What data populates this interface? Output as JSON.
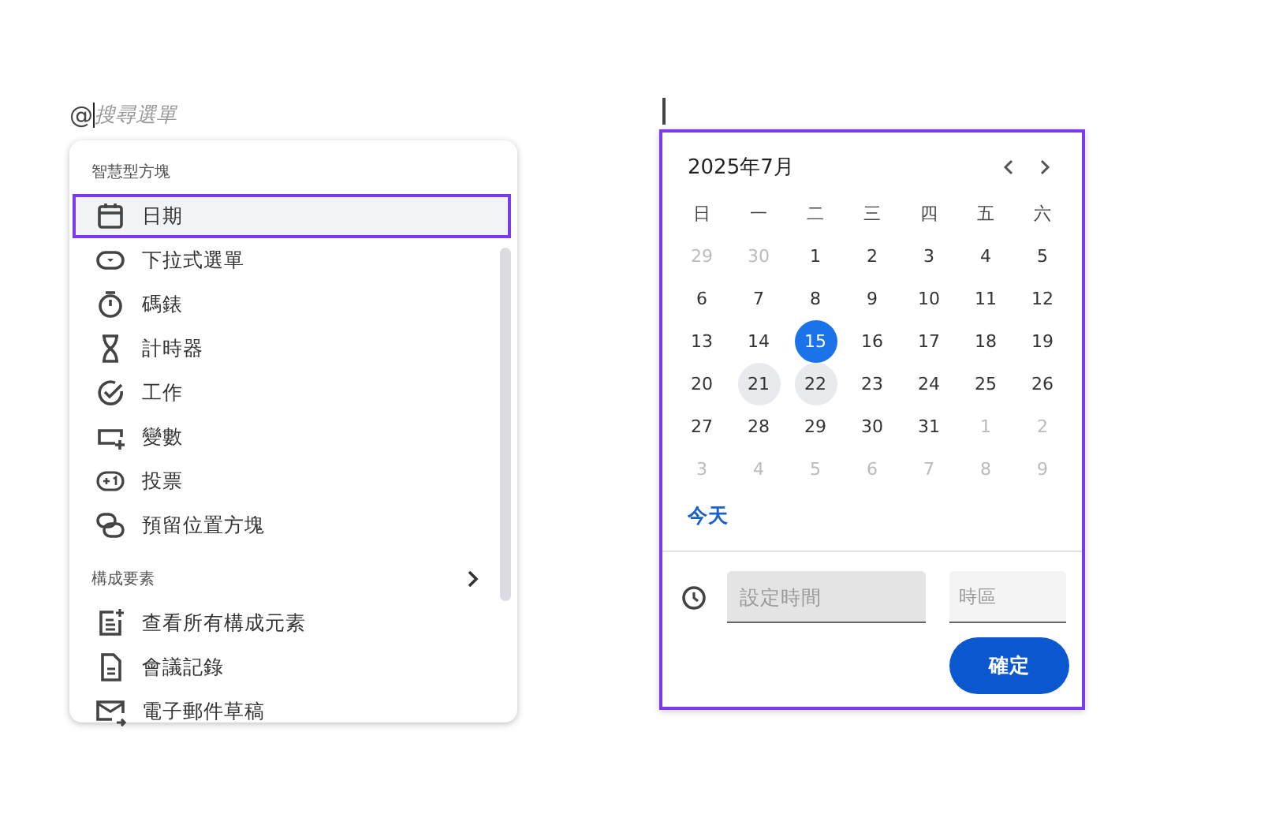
{
  "search": {
    "prefix": "@",
    "placeholder": "搜尋選單"
  },
  "menu": {
    "sections": [
      {
        "title": "智慧型方塊",
        "has_submenu": false,
        "items": [
          {
            "label": "日期",
            "kind": "calendar",
            "selected": true
          },
          {
            "label": "下拉式選單",
            "kind": "dropdown",
            "selected": false
          },
          {
            "label": "碼錶",
            "kind": "stopwatch",
            "selected": false
          },
          {
            "label": "計時器",
            "kind": "hourglass",
            "selected": false
          },
          {
            "label": "工作",
            "kind": "task",
            "selected": false
          },
          {
            "label": "變數",
            "kind": "variable",
            "selected": false
          },
          {
            "label": "投票",
            "kind": "vote",
            "selected": false
          },
          {
            "label": "預留位置方塊",
            "kind": "placeholder",
            "selected": false
          }
        ]
      },
      {
        "title": "構成要素",
        "has_submenu": true,
        "items": [
          {
            "label": "查看所有構成元素",
            "kind": "note-add",
            "selected": false
          },
          {
            "label": "會議記錄",
            "kind": "document",
            "selected": false
          },
          {
            "label": "電子郵件草稿",
            "kind": "mail",
            "selected": false
          }
        ]
      }
    ]
  },
  "calendar": {
    "title": "2025年7月",
    "weekdays": [
      "日",
      "一",
      "二",
      "三",
      "四",
      "五",
      "六"
    ],
    "days": [
      {
        "label": "29",
        "muted": true,
        "selected": false,
        "highlighted": false
      },
      {
        "label": "30",
        "muted": true,
        "selected": false,
        "highlighted": false
      },
      {
        "label": "1",
        "muted": false,
        "selected": false,
        "highlighted": false
      },
      {
        "label": "2",
        "muted": false,
        "selected": false,
        "highlighted": false
      },
      {
        "label": "3",
        "muted": false,
        "selected": false,
        "highlighted": false
      },
      {
        "label": "4",
        "muted": false,
        "selected": false,
        "highlighted": false
      },
      {
        "label": "5",
        "muted": false,
        "selected": false,
        "highlighted": false
      },
      {
        "label": "6",
        "muted": false,
        "selected": false,
        "highlighted": false
      },
      {
        "label": "7",
        "muted": false,
        "selected": false,
        "highlighted": false
      },
      {
        "label": "8",
        "muted": false,
        "selected": false,
        "highlighted": false
      },
      {
        "label": "9",
        "muted": false,
        "selected": false,
        "highlighted": false
      },
      {
        "label": "10",
        "muted": false,
        "selected": false,
        "highlighted": false
      },
      {
        "label": "11",
        "muted": false,
        "selected": false,
        "highlighted": false
      },
      {
        "label": "12",
        "muted": false,
        "selected": false,
        "highlighted": false
      },
      {
        "label": "13",
        "muted": false,
        "selected": false,
        "highlighted": false
      },
      {
        "label": "14",
        "muted": false,
        "selected": false,
        "highlighted": false
      },
      {
        "label": "15",
        "muted": false,
        "selected": true,
        "highlighted": false
      },
      {
        "label": "16",
        "muted": false,
        "selected": false,
        "highlighted": false
      },
      {
        "label": "17",
        "muted": false,
        "selected": false,
        "highlighted": false
      },
      {
        "label": "18",
        "muted": false,
        "selected": false,
        "highlighted": false
      },
      {
        "label": "19",
        "muted": false,
        "selected": false,
        "highlighted": false
      },
      {
        "label": "20",
        "muted": false,
        "selected": false,
        "highlighted": false
      },
      {
        "label": "21",
        "muted": false,
        "selected": false,
        "highlighted": true
      },
      {
        "label": "22",
        "muted": false,
        "selected": false,
        "highlighted": true
      },
      {
        "label": "23",
        "muted": false,
        "selected": false,
        "highlighted": false
      },
      {
        "label": "24",
        "muted": false,
        "selected": false,
        "highlighted": false
      },
      {
        "label": "25",
        "muted": false,
        "selected": false,
        "highlighted": false
      },
      {
        "label": "26",
        "muted": false,
        "selected": false,
        "highlighted": false
      },
      {
        "label": "27",
        "muted": false,
        "selected": false,
        "highlighted": false
      },
      {
        "label": "28",
        "muted": false,
        "selected": false,
        "highlighted": false
      },
      {
        "label": "29",
        "muted": false,
        "selected": false,
        "highlighted": false
      },
      {
        "label": "30",
        "muted": false,
        "selected": false,
        "highlighted": false
      },
      {
        "label": "31",
        "muted": false,
        "selected": false,
        "highlighted": false
      },
      {
        "label": "1",
        "muted": true,
        "selected": false,
        "highlighted": false
      },
      {
        "label": "2",
        "muted": true,
        "selected": false,
        "highlighted": false
      },
      {
        "label": "3",
        "muted": true,
        "selected": false,
        "highlighted": false
      },
      {
        "label": "4",
        "muted": true,
        "selected": false,
        "highlighted": false
      },
      {
        "label": "5",
        "muted": true,
        "selected": false,
        "highlighted": false
      },
      {
        "label": "6",
        "muted": true,
        "selected": false,
        "highlighted": false
      },
      {
        "label": "7",
        "muted": true,
        "selected": false,
        "highlighted": false
      },
      {
        "label": "8",
        "muted": true,
        "selected": false,
        "highlighted": false
      },
      {
        "label": "9",
        "muted": true,
        "selected": false,
        "highlighted": false
      }
    ],
    "today_link": "今天",
    "time_field": {
      "placeholder": "設定時間"
    },
    "timezone_field": {
      "placeholder": "時區"
    },
    "confirm_button": "確定"
  }
}
